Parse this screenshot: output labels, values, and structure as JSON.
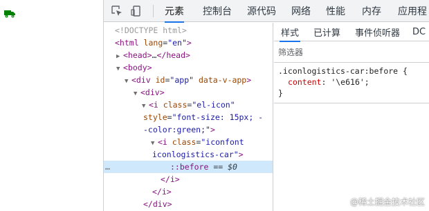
{
  "colors": {
    "accent": "#1a73e8",
    "truck": "#008000",
    "selected_row": "#cfe8fc"
  },
  "page_preview": {
    "icon": "truck-icon"
  },
  "toolbar": {
    "inspect_icon": "inspect-element-icon",
    "device_icon": "device-toolbar-icon",
    "tabs": [
      {
        "label": "元素",
        "active": true
      },
      {
        "label": "控制台"
      },
      {
        "label": "源代码"
      },
      {
        "label": "网络"
      },
      {
        "label": "性能"
      },
      {
        "label": "内存"
      },
      {
        "label": "应用程"
      }
    ]
  },
  "dom": {
    "lines": [
      {
        "text": "<!DOCTYPE html>"
      },
      {
        "tag_open": "<html ",
        "attr": "lang",
        "val": "\"en\"",
        "tag_close": ">"
      },
      {
        "tri": "▶",
        "tag": "<head>",
        "txt": "…",
        "tag_end": "</head>"
      },
      {
        "tri": "▼",
        "tag": "<body>"
      },
      {
        "tri": "▼",
        "tag_open": "<div ",
        "attr": "id",
        "val": "\"app\"",
        "attr2": "data-v-app",
        "tag_close": ">"
      },
      {
        "tri": "▼",
        "tag": "<div>"
      },
      {
        "tri": "▼",
        "tag_open": "<i ",
        "attr": "class",
        "val": "\"el-icon\""
      },
      {
        "attr": "style",
        "val": "\"font-size: 15px; -"
      },
      {
        "val": "-color:green;\"",
        "tag_close": ">"
      },
      {
        "tri": "▼",
        "tag_open": "<i ",
        "attr": "class",
        "val": "\"iconfont"
      },
      {
        "val": "iconlogistics-car\"",
        "tag_close": ">"
      },
      {
        "marker": "…",
        "pseudo": "::before",
        "eq": " == ",
        "ref": "$0"
      },
      {
        "tag": "</i>"
      },
      {
        "tag": "</i>"
      },
      {
        "tag": "</div>"
      }
    ]
  },
  "styles": {
    "sub_tabs": [
      {
        "label": "样式",
        "active": true
      },
      {
        "label": "已计算"
      },
      {
        "label": "事件侦听器"
      },
      {
        "label": "DC"
      }
    ],
    "filter_placeholder": "筛选器",
    "rule": {
      "selector": ".iconlogistics-car:before {",
      "prop": "content",
      "value": "'\\e616';",
      "close": "}"
    }
  },
  "watermark": "@稀土掘金技术社区"
}
